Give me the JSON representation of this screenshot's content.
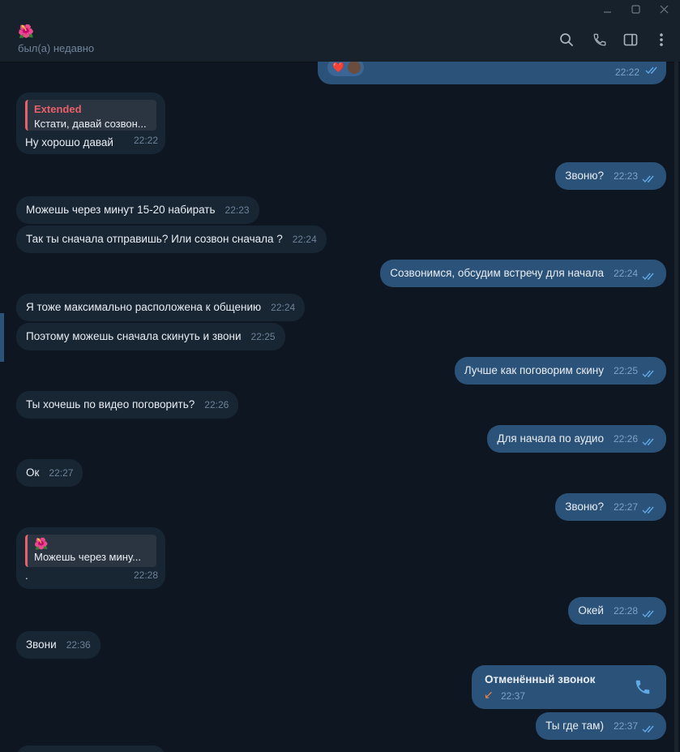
{
  "window": {
    "minimize_icon": "minimize-icon",
    "maximize_icon": "maximize-icon",
    "close_icon": "close-icon"
  },
  "header": {
    "peer_emoji": "🌺",
    "status": "был(а) недавно",
    "icons": [
      "search-icon",
      "phone-icon",
      "sidebar-toggle-icon",
      "more-vertical-icon"
    ]
  },
  "colors": {
    "background": "#0e1621",
    "incoming": "#182533",
    "outgoing": "#2b5278",
    "header": "#17212b",
    "reply_accent": "#e8606a",
    "read_check": "#5fa9e6"
  },
  "messages": {
    "m0": {
      "reactions": "❤️",
      "time": "22:22"
    },
    "m1": {
      "reply_author": "Extended",
      "reply_text": "Кстати, давай созвон...",
      "text": "Ну хорошо давай",
      "time": "22:22"
    },
    "m2": {
      "text": "Звоню?",
      "time": "22:23"
    },
    "m3": {
      "text": "Можешь через минут 15-20 набирать",
      "time": "22:23"
    },
    "m4": {
      "text": "Так ты сначала отправишь? Или созвон сначала ?",
      "time": "22:24"
    },
    "m5": {
      "text": "Созвонимся, обсудим встречу для начала",
      "time": "22:24"
    },
    "m6": {
      "text": "Я тоже максимально расположена к общению",
      "time": "22:24"
    },
    "m7": {
      "text": "Поэтому можешь сначала скинуть и звони",
      "time": "22:25"
    },
    "m8": {
      "text": "Лучше как поговорим скину",
      "time": "22:25"
    },
    "m9": {
      "text": "Ты хочешь по видео поговорить?",
      "time": "22:26"
    },
    "m10": {
      "text": "Для начала по аудио",
      "time": "22:26"
    },
    "m11": {
      "text": "Ок",
      "time": "22:27"
    },
    "m12": {
      "text": "Звоню?",
      "time": "22:27"
    },
    "m13": {
      "reply_author": "🌺",
      "reply_text": "Можешь через мину...",
      "text": ".",
      "time": "22:28"
    },
    "m14": {
      "text": "Окей",
      "time": "22:28"
    },
    "m15": {
      "text": "Звони",
      "time": "22:36"
    },
    "m16": {
      "call_title": "Отменённый звонок",
      "call_arrow": "↙",
      "time": "22:37"
    },
    "m17": {
      "text": "Ты где там)",
      "time": "22:37"
    }
  }
}
